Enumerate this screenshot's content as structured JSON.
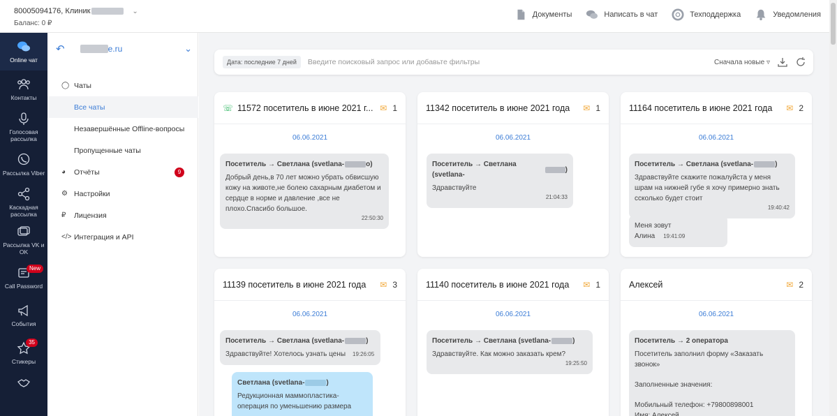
{
  "header": {
    "account_number": "80005094176, Клиник",
    "balance": "Баланс: 0 ₽",
    "actions": [
      {
        "label": "Документы",
        "icon": "document-icon"
      },
      {
        "label": "Написать в чат",
        "icon": "chat-icon"
      },
      {
        "label": "Техподдержка",
        "icon": "lifebuoy-icon"
      },
      {
        "label": "Уведомления",
        "icon": "bell-icon"
      }
    ]
  },
  "leftnav": {
    "items": [
      {
        "label": "Online чат",
        "icon": "chat-bubbles-icon"
      },
      {
        "label": "Контакты",
        "icon": "users-icon"
      },
      {
        "label": "Голосовая рассылка",
        "icon": "microphone-icon"
      },
      {
        "label": "Рассылка Viber",
        "icon": "viber-icon"
      },
      {
        "label": "Каскадная рассылка",
        "icon": "share-icon"
      },
      {
        "label": "Рассылка VK и OK",
        "icon": "vk-ok-icon"
      },
      {
        "label": "Call Password",
        "icon": "phone-icon",
        "badge": "New"
      },
      {
        "label": "События",
        "icon": "megaphone-icon"
      },
      {
        "label": "Стикеры",
        "icon": "star-icon",
        "badge": "35"
      }
    ]
  },
  "sidebar": {
    "domain": "e.ru",
    "menu": [
      {
        "label": "Чаты",
        "icon": "chats-icon"
      },
      {
        "label": "Все чаты"
      },
      {
        "label": "Незавершённые Offline-вопросы"
      },
      {
        "label": "Пропущенные чаты"
      },
      {
        "label": "Отчёты",
        "icon": "reports-icon",
        "count": "9"
      },
      {
        "label": "Настройки",
        "icon": "gear-icon"
      },
      {
        "label": "Лицензия",
        "icon": "ruble-icon"
      },
      {
        "label": "Интеграция и API",
        "icon": "code-icon"
      }
    ]
  },
  "search": {
    "chip": "Дата: последние 7 дней",
    "placeholder": "Введите поисковый запрос или добавьте фильтры",
    "sort": "Сначала новые"
  },
  "cards": [
    {
      "title": "11572 посетитель в июне 2021 г...",
      "count": "1",
      "date": "06.06.2021",
      "messages": [
        {
          "header": "Посетитель → Светлана (svetlana-",
          "header_tail": "o)",
          "text": "Добрый день,в 70 лет можно убрать обвисшую кожу на животе,не болею сахарным диабетом и сердце в норме и давление ,все не плохо.Спасибо большое.",
          "time": "22:50:30"
        }
      ]
    },
    {
      "title": "11342 посетитель в июне 2021 года",
      "count": "1",
      "date": "06.06.2021",
      "messages": [
        {
          "header": "Посетитель → Светлана (svetlana-",
          "header_tail": ")",
          "text": "Здравствуйте",
          "time": "21:04:33"
        }
      ]
    },
    {
      "title": "11164 посетитель в июне 2021 года",
      "count": "2",
      "date": "06.06.2021",
      "messages": [
        {
          "header": "Посетитель → Светлана (svetlana-",
          "header_tail": ")",
          "text": "Здравствуйте скажите пожалуйста у меня шрам на нижней губе я хочу примерно знать ссколько будет стоит",
          "time": "19:40:42"
        },
        {
          "text": "Меня зовут Алина",
          "time": "19:41:09"
        }
      ]
    },
    {
      "title": "11139 посетитель в июне 2021 года",
      "count": "3",
      "date": "06.06.2021",
      "messages": [
        {
          "header": "Посетитель → Светлана (svetlana-",
          "header_tail": ")",
          "text": "Здравствуйте! Хотелось узнать цены",
          "time": "19:26:05"
        },
        {
          "header": "Светлана (svetlana-",
          "header_tail": ")",
          "text": "Редукционная маммопластика-операция по уменьшению размера"
        }
      ]
    },
    {
      "title": "11140 посетитель в июне 2021 года",
      "count": "1",
      "date": "06.06.2021",
      "messages": [
        {
          "header": "Посетитель → Светлана (svetlana-",
          "header_tail": ")",
          "text": "Здравствуйте.  Как можно заказать крем?",
          "time": "19:25:50"
        }
      ]
    },
    {
      "title": "Алексей",
      "count": "2",
      "date": "06.06.2021",
      "messages": [
        {
          "header": "Посетитель → 2 оператора",
          "text": "Посетитель заполнил форму «Заказать звонок»",
          "extra1": "Заполненные значения:",
          "extra2": "Мобильный телефон: +79800898001",
          "extra3": "Имя: Алексей"
        }
      ]
    }
  ]
}
